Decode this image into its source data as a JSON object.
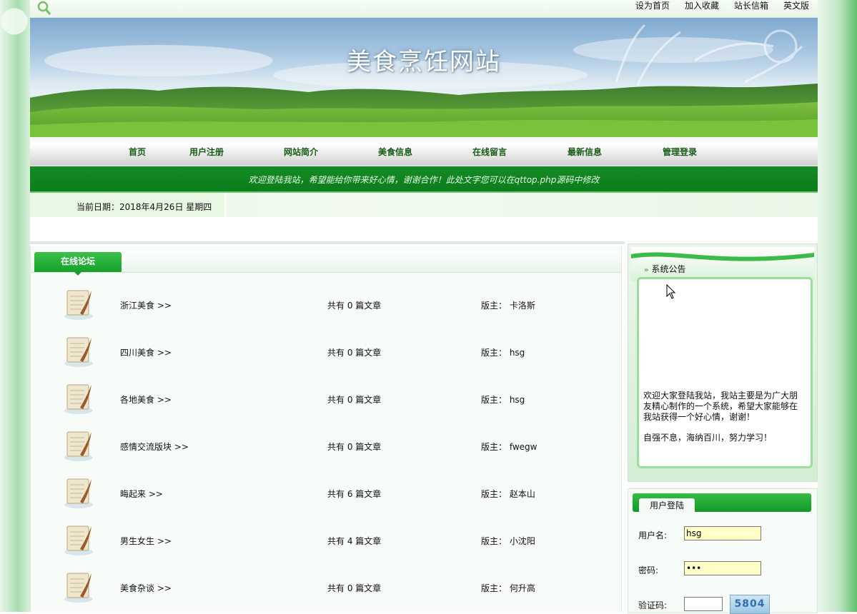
{
  "top_links": [
    "设为首页",
    "加入收藏",
    "站长信箱",
    "英文版"
  ],
  "site_title": "美食烹饪网站",
  "nav": [
    "首页",
    "用户注册",
    "网站简介",
    "美食信息",
    "在线留言",
    "最新信息",
    "管理登录"
  ],
  "marquee_text": "欢迎登陆我站，希望能给你带来好心情，谢谢合作！此处文字您可以在qttop.php源码中修改",
  "current_date": "当前日期：2018年4月26日 星期四",
  "forum": {
    "tab_label": "在线论坛",
    "rows": [
      {
        "name": "浙江美食 >>",
        "count": "共有 0 篇文章",
        "moderator": "版主： 卡洛斯"
      },
      {
        "name": "四川美食 >>",
        "count": "共有 0 篇文章",
        "moderator": "版主： hsg"
      },
      {
        "name": "各地美食 >>",
        "count": "共有 0 篇文章",
        "moderator": "版主： hsg"
      },
      {
        "name": "感情交流版块 >>",
        "count": "共有 0 篇文章",
        "moderator": "版主： fwegw"
      },
      {
        "name": "晦起来 >>",
        "count": "共有 6 篇文章",
        "moderator": "版主： 赵本山"
      },
      {
        "name": "男生女生 >>",
        "count": "共有 4 篇文章",
        "moderator": "版主： 小沈阳"
      },
      {
        "name": "美食杂谈 >>",
        "count": "共有 0 篇文章",
        "moderator": "版主： 何升高"
      }
    ]
  },
  "notice": {
    "title": "系统公告",
    "paragraph1": "欢迎大家登陆我站，我站主要是为广大朋友精心制作的一个系统，希望大家能够在我站获得一个好心情，谢谢！",
    "paragraph2": "自强不息，海纳百川，努力学习！"
  },
  "login": {
    "title": "用户登陆",
    "username_label": "用户名:",
    "username_value": "hsg",
    "password_label": "密码:",
    "password_value": "•••",
    "captcha_label": "验证码:",
    "captcha_code": "5804"
  }
}
